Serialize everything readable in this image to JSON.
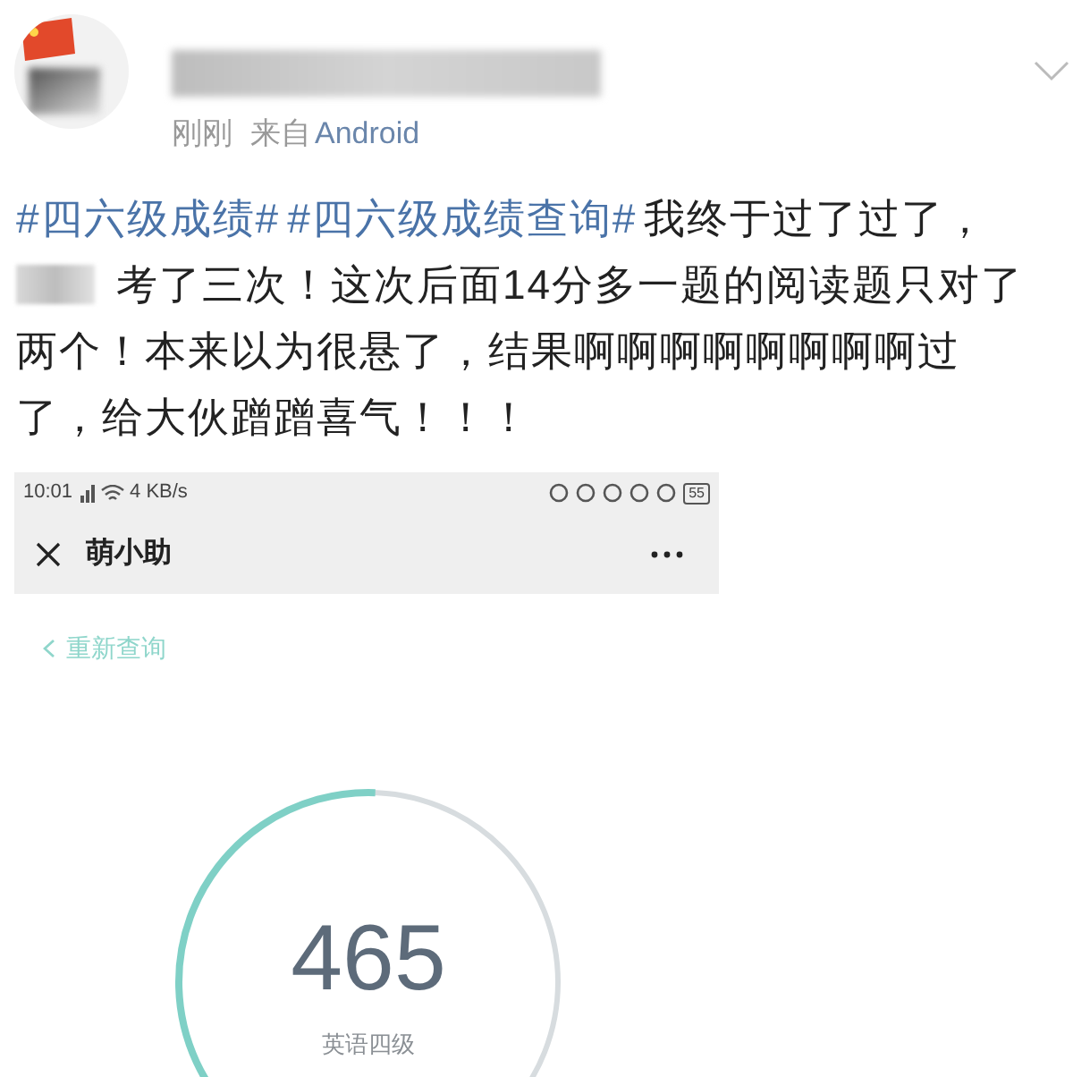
{
  "post": {
    "author": {
      "time": "刚刚",
      "source_prefix": "来自",
      "source": "Android"
    },
    "lines": [
      {
        "segments": [
          {
            "kind": "hashtag",
            "text": "#四六级成绩#"
          },
          {
            "kind": "hashtag",
            "text": "#四六级成绩查询#"
          },
          {
            "kind": "text",
            "text": "我终于过了过了，"
          }
        ]
      },
      {
        "segments": [
          {
            "kind": "blurred"
          },
          {
            "kind": "text",
            "text": "考了三次！这次后面14分多一题的阅读题只对了"
          }
        ]
      },
      {
        "segments": [
          {
            "kind": "text",
            "text": "两个！本来以为很悬了，结果啊啊啊啊啊啊啊啊过"
          }
        ]
      },
      {
        "segments": [
          {
            "kind": "text",
            "text": "了，给大伙蹭蹭喜气！！！"
          }
        ]
      }
    ],
    "embedded": {
      "status_bar": {
        "time": "10:01",
        "speed": "4 KB/s",
        "battery": "55"
      },
      "title": "萌小助",
      "back_link": "重新查询",
      "score": {
        "value": "465",
        "label": "英语四级"
      }
    }
  }
}
